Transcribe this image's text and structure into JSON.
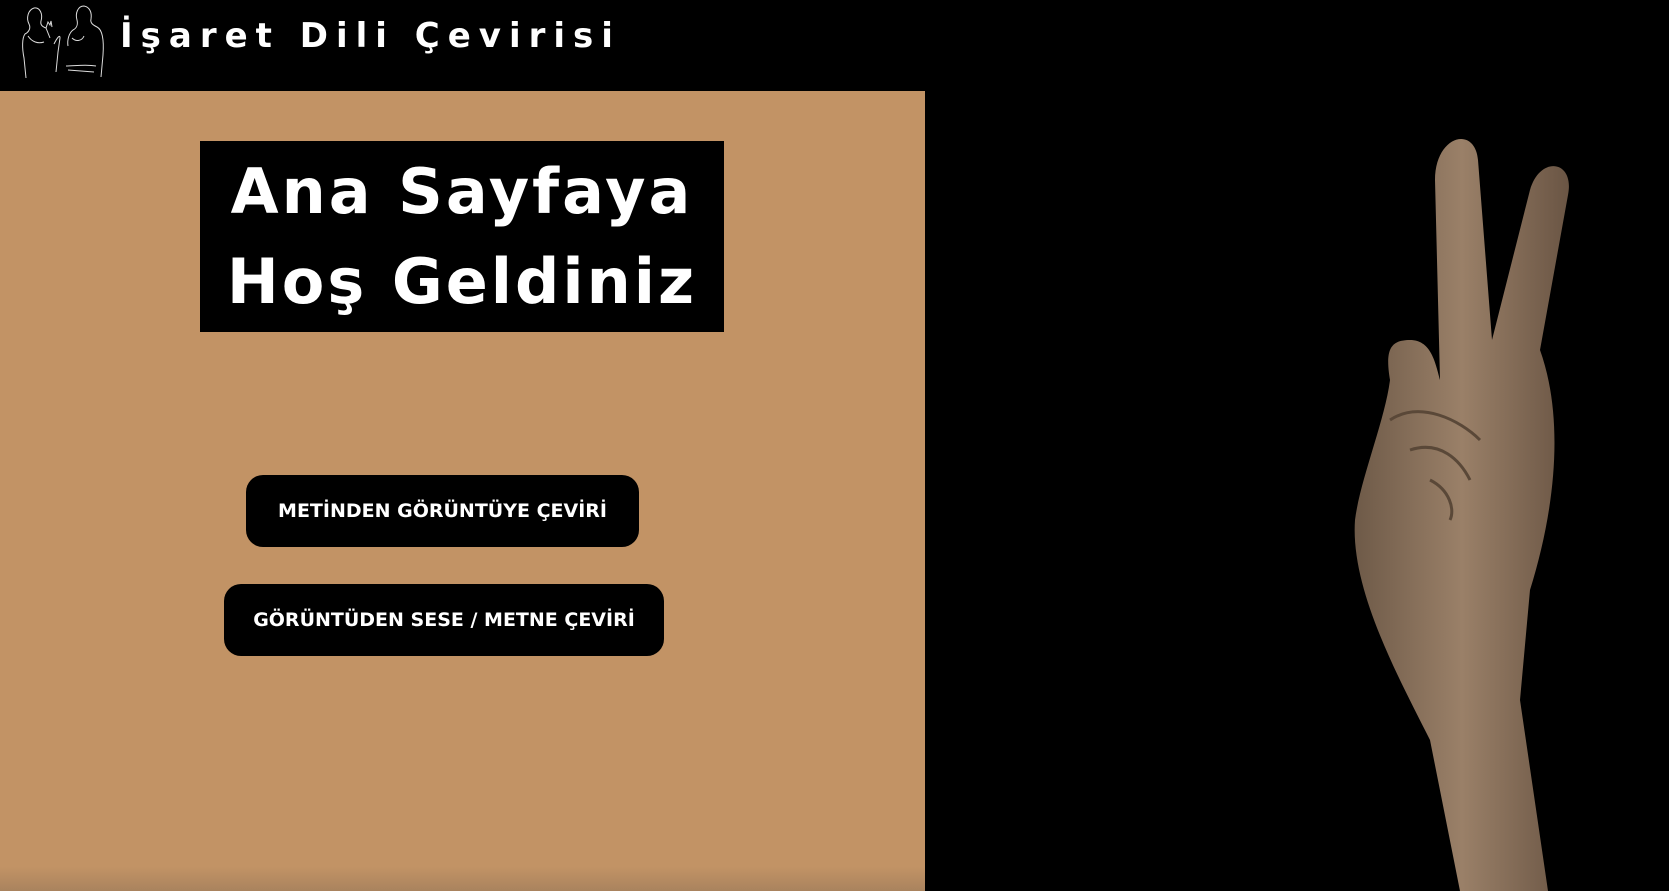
{
  "header": {
    "title": "İşaret Dili Çevirisi",
    "logo_icon": "sign-language-people-logo"
  },
  "main": {
    "welcome_line1": "Ana Sayfaya",
    "welcome_line2": "Hoş Geldiniz",
    "buttons": [
      {
        "label": "METİNDEN GÖRÜNTÜYE ÇEVİRİ"
      },
      {
        "label": "GÖRÜNTÜDEN SESE / METNE ÇEVİRİ"
      }
    ]
  },
  "colors": {
    "panel": "#c29365",
    "background": "#000000",
    "skin": "#8a6f56"
  }
}
